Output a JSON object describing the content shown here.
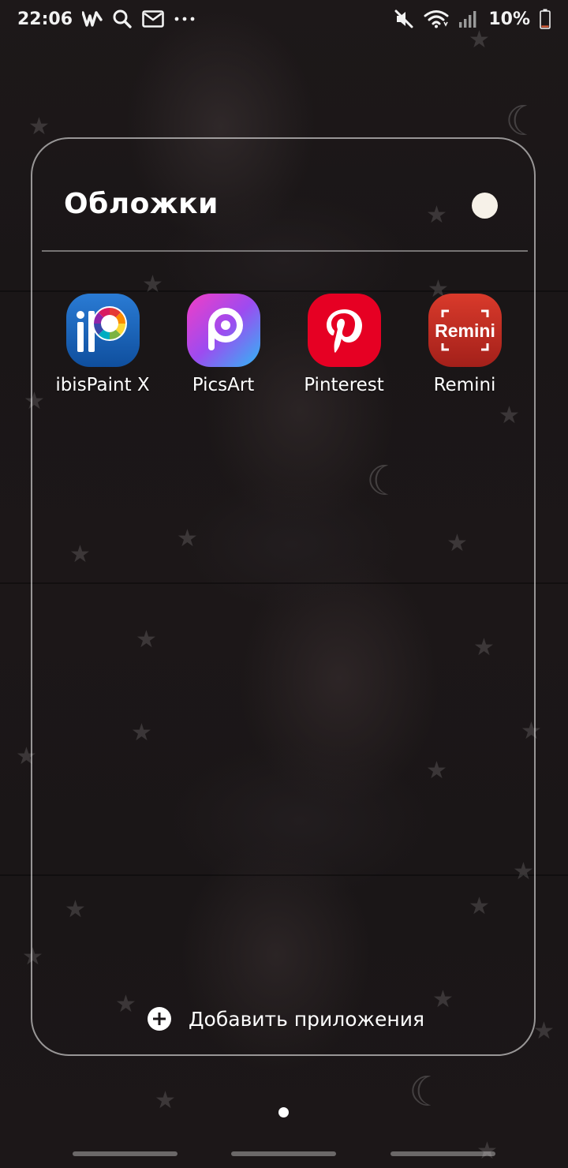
{
  "status_bar": {
    "time": "22:06",
    "left_icons": [
      "w-app-icon",
      "search-icon",
      "mail-icon",
      "more-dots-icon"
    ],
    "right_icons": [
      "mute-icon",
      "wifi-icon",
      "signal-icon"
    ],
    "battery_percent": "10%",
    "battery_level": 0.1,
    "battery_color": "#e0603a"
  },
  "folder": {
    "title": "Обложки",
    "color_dot": "#f6f1e8",
    "apps": [
      {
        "label": "ibisPaint X",
        "icon": "ibispaint-icon"
      },
      {
        "label": "PicsArt",
        "icon": "picsart-icon"
      },
      {
        "label": "Pinterest",
        "icon": "pinterest-icon"
      },
      {
        "label": "Remini",
        "icon": "remini-icon"
      }
    ],
    "add_apps_label": "Добавить приложения",
    "remini_icon_text": "Remini"
  },
  "home": {
    "page_count": 1,
    "current_page": 1
  }
}
